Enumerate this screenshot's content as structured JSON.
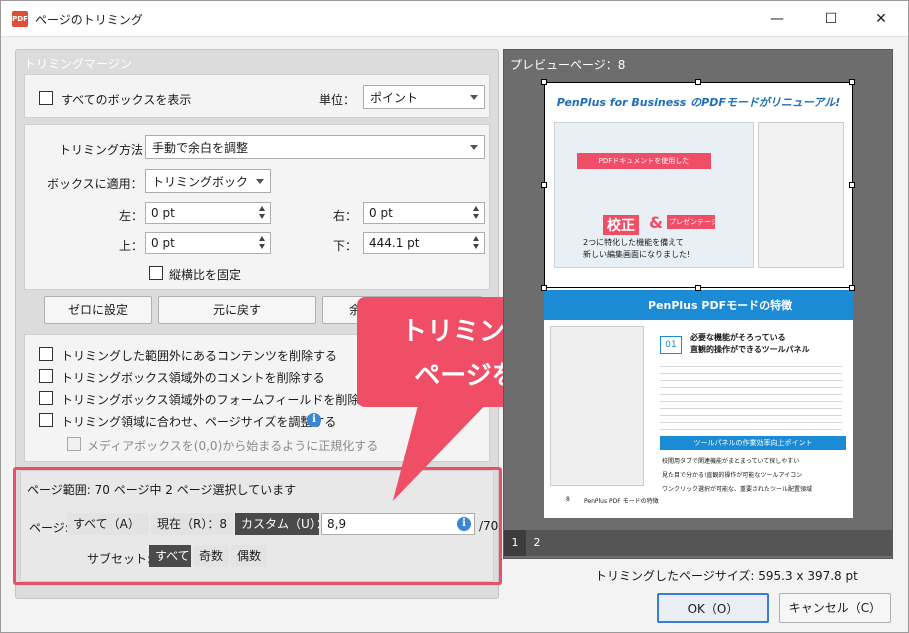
{
  "window": {
    "title": "ページのトリミング",
    "app_icon_text": "PDF",
    "controls": {
      "minimize": "—",
      "maximize": "☐",
      "close": "✕"
    }
  },
  "trim_margin": {
    "header": "トリミングマージン",
    "show_all_boxes": "すべてのボックスを表示",
    "unit_label": "単位：",
    "unit_value": "ポイント",
    "method_label": "トリミング方法：",
    "method_value": "手動で余白を調整",
    "apply_label": "ボックスに適用：",
    "apply_value": "トリミングボック",
    "left_label": "左：",
    "left_value": "0 pt",
    "right_label": "右：",
    "right_value": "0 pt",
    "top_label": "上：",
    "top_value": "0 pt",
    "bottom_label": "下：",
    "bottom_value": "444.1 pt",
    "keep_ratio": "縦横比を固定",
    "btn_zero": "ゼロに設定",
    "btn_revert": "元に戻す",
    "btn_third": "余",
    "options": [
      "トリミングした範囲外にあるコンテンツを削除する",
      "トリミングボックス領域外のコメントを削除する",
      "トリミングボックス領域外のフォームフィールドを削除する",
      "トリミング領域に合わせ、ページサイズを調整する"
    ],
    "normalize_option": "メディアボックスを(0,0)から始まるように正規化する"
  },
  "page_range": {
    "summary": "ページ範囲: 70 ページ中 2 ページ選択しています",
    "page_label": "ページ:",
    "seg_all": "すべて（A）",
    "seg_current": "現在（R）：8",
    "seg_custom": "カスタム（U）：",
    "custom_value": "8,9",
    "total": "/70",
    "subset_label": "サブセット:",
    "subset_all": "すべて",
    "subset_odd": "奇数",
    "subset_even": "偶数"
  },
  "callout": {
    "line1": "トリミングする",
    "line2": "ページを指定"
  },
  "preview": {
    "header": "プレビューページ：8",
    "page_title_top": "PenPlus for Business のPDFモードがリニューアル!",
    "banner_text": "PDFドキュメントを使用した",
    "word_correct": "校正",
    "word_and": "&",
    "word_present": "プレゼンテーション",
    "banner_sub1": "2つに特化した機能を備えて",
    "banner_sub2": "新しい編集画面になりました!",
    "section_title": "PenPlus PDFモードの特徴",
    "item_number": "01",
    "item_heading1": "必要な機能がそろっている",
    "item_heading2": "直観的操作ができるツールパネル",
    "blue_bar": "ツールパネルの作業効率向上ポイント",
    "points": [
      "校閲用タブで関連機能がまとまっていて探しやすい",
      "見た目で分かる!直観的操作が可能なツールアイコン",
      "ワンクリック選択が可能な、重要されたツール配置領域"
    ],
    "footer_num": "8",
    "footer_text": "PenPlus PDF モードの特徴",
    "tabs": [
      "1",
      "2"
    ],
    "size_text": "トリミングしたページサイズ: 595.3 x 397.8 pt"
  },
  "buttons": {
    "ok": "OK（O）",
    "cancel": "キャンセル（C）"
  },
  "colors": {
    "accent_red": "#f04d67",
    "dark_segment": "#4a4a4a",
    "preview_bg": "#6d6d6d",
    "blue": "#1c8bd6"
  }
}
